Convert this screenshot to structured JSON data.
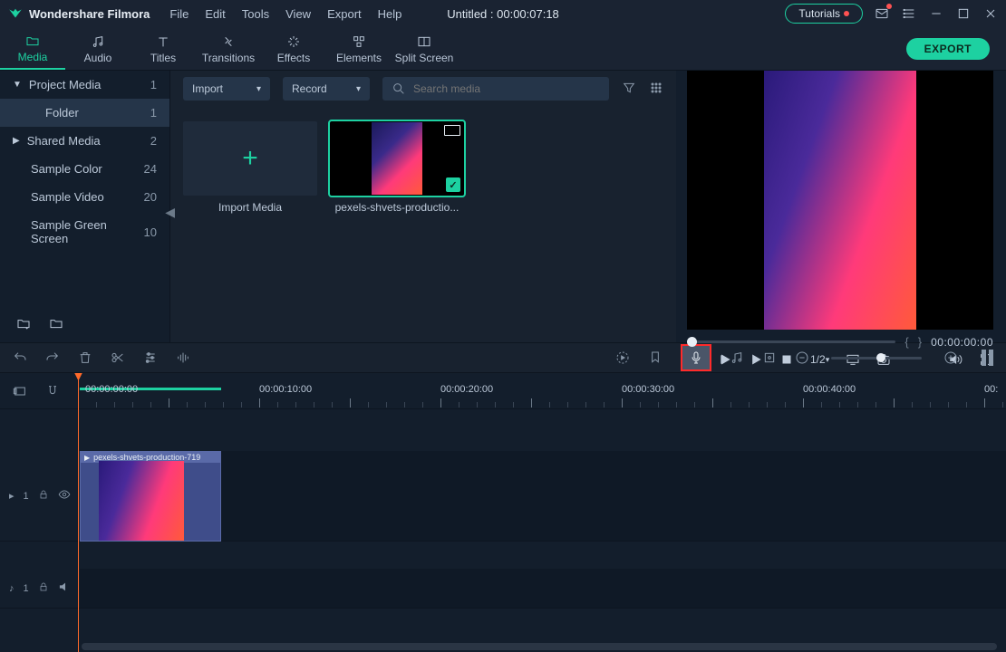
{
  "titlebar": {
    "app_name": "Wondershare Filmora",
    "menus": [
      "File",
      "Edit",
      "Tools",
      "View",
      "Export",
      "Help"
    ],
    "document_title": "Untitled : 00:00:07:18",
    "tutorials_label": "Tutorials"
  },
  "ribbon": {
    "tabs": [
      {
        "label": "Media",
        "icon": "folder-icon",
        "active": true
      },
      {
        "label": "Audio",
        "icon": "music-icon"
      },
      {
        "label": "Titles",
        "icon": "text-icon"
      },
      {
        "label": "Transitions",
        "icon": "transition-icon"
      },
      {
        "label": "Effects",
        "icon": "sparkle-icon"
      },
      {
        "label": "Elements",
        "icon": "elements-icon"
      },
      {
        "label": "Split Screen",
        "icon": "split-icon"
      }
    ],
    "export_label": "EXPORT"
  },
  "sidebar": {
    "items": [
      {
        "label": "Project Media",
        "count": "1",
        "chev": "down",
        "sel": false
      },
      {
        "label": "Folder",
        "count": "1",
        "chev": "",
        "sel": true,
        "folder": true
      },
      {
        "label": "Shared Media",
        "count": "2",
        "chev": "right",
        "sel": false
      },
      {
        "label": "Sample Color",
        "count": "24",
        "chev": "",
        "sel": false,
        "sub": true
      },
      {
        "label": "Sample Video",
        "count": "20",
        "chev": "",
        "sel": false,
        "sub": true
      },
      {
        "label": "Sample Green Screen",
        "count": "10",
        "chev": "",
        "sel": false,
        "sub": true
      }
    ]
  },
  "browser": {
    "import_label": "Import",
    "record_label": "Record",
    "search_placeholder": "Search media",
    "import_media_label": "Import Media",
    "clip_name": "pexels-shvets-productio..."
  },
  "preview": {
    "timecode": "00:00:00:00",
    "playback_rate": "1/2"
  },
  "timeline": {
    "times": [
      "00:00:00:00",
      "00:00:10:00",
      "00:00:20:00",
      "00:00:30:00",
      "00:00:40:00",
      "00:"
    ],
    "video_track_label": "1",
    "audio_track_label": "1",
    "clip_label": "pexels-shvets-production-719"
  }
}
